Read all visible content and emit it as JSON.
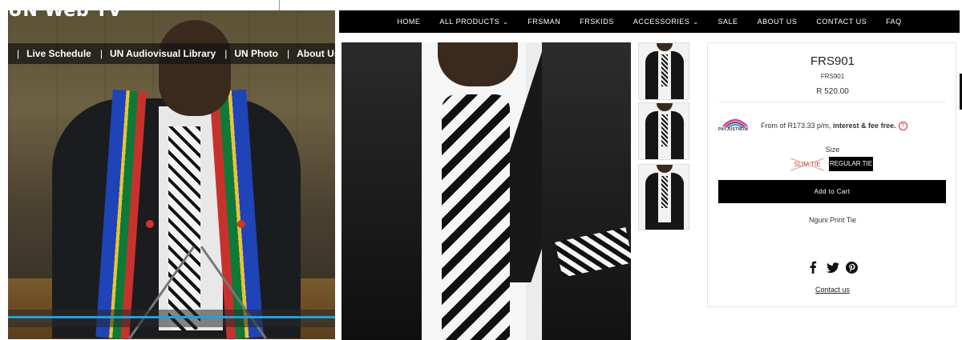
{
  "untv": {
    "logo": "UN Web TV",
    "nav": [
      "Live Schedule",
      "UN Audiovisual Library",
      "UN Photo",
      "About Us"
    ],
    "separator": "|",
    "progress_fraction": 1.0,
    "progress_color": "#1aa3e0"
  },
  "store": {
    "nav": [
      {
        "label": "HOME",
        "dropdown": false
      },
      {
        "label": "ALL PRODUCTS",
        "dropdown": true
      },
      {
        "label": "FRSMAN",
        "dropdown": false
      },
      {
        "label": "FRSKIDS",
        "dropdown": false
      },
      {
        "label": "ACCESSORIES",
        "dropdown": true
      },
      {
        "label": "SALE",
        "dropdown": false
      },
      {
        "label": "ABOUT US",
        "dropdown": false
      },
      {
        "label": "CONTACT US",
        "dropdown": false
      },
      {
        "label": "FAQ",
        "dropdown": false
      }
    ],
    "caret": "⌄",
    "product": {
      "title": "FRS901",
      "sku": "FRS901",
      "price": "R 520.00",
      "payjustnow_brand": "PAYJUSTNOW",
      "installment_prefix": "From of R173.33 p/m, ",
      "installment_bold": "interest & fee free.",
      "info_icon": "?",
      "size_label": "Size",
      "sizes": [
        {
          "label": "SLIM TIE",
          "available": false
        },
        {
          "label": "REGULAR TIE",
          "available": true,
          "selected": true
        }
      ],
      "add_to_cart": "Add to Cart",
      "description": "Nguni Print Tie",
      "social_icons": [
        "facebook-icon",
        "twitter-icon",
        "pinterest-icon"
      ],
      "contact_link": "Contact us"
    }
  }
}
